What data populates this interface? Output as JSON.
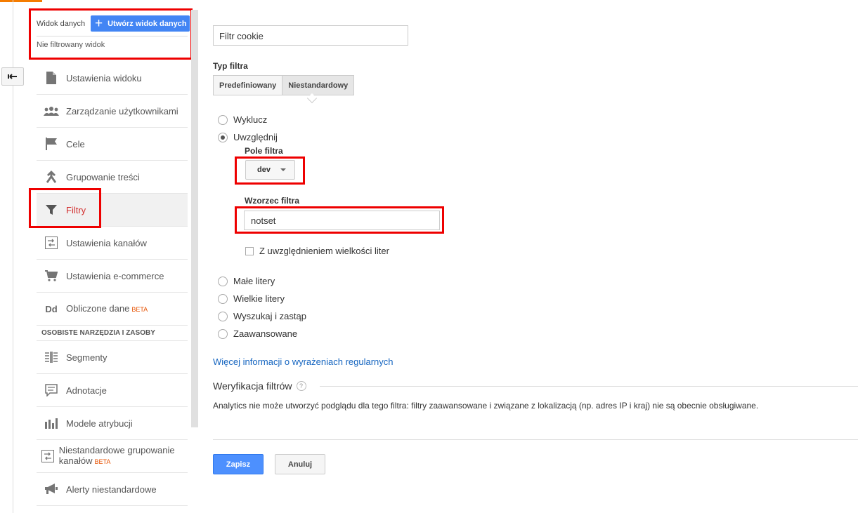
{
  "view": {
    "label": "Widok danych",
    "create_button": "Utwórz widok danych",
    "selected": "Nie filtrowany widok"
  },
  "sidebar": {
    "items": [
      {
        "label": "Ustawienia widoku",
        "icon": "document-icon"
      },
      {
        "label": "Zarządzanie użytkownikami",
        "icon": "users-icon"
      },
      {
        "label": "Cele",
        "icon": "flag-icon"
      },
      {
        "label": "Grupowanie treści",
        "icon": "merge-icon"
      },
      {
        "label": "Filtry",
        "icon": "filter-icon",
        "active": true
      },
      {
        "label": "Ustawienia kanałów",
        "icon": "channel-icon"
      },
      {
        "label": "Ustawienia e-commerce",
        "icon": "cart-icon"
      },
      {
        "label": "Obliczone dane",
        "beta": "BETA",
        "icon": "dd-icon"
      }
    ],
    "section_title": "OSOBISTE NARZĘDZIA I ZASOBY",
    "personal_items": [
      {
        "label": "Segmenty",
        "icon": "segments-icon"
      },
      {
        "label": "Adnotacje",
        "icon": "annotation-icon"
      },
      {
        "label": "Modele atrybucji",
        "icon": "bar-chart-icon"
      },
      {
        "label": "Niestandardowe grupowanie kanałów",
        "beta": "BETA",
        "icon": "channel-icon"
      },
      {
        "label": "Alerty niestandardowe",
        "icon": "megaphone-icon"
      }
    ],
    "dd_glyph": "Dd"
  },
  "form": {
    "filter_name": "Filtr cookie",
    "filter_type_label": "Typ filtra",
    "type_predefined": "Predefiniowany",
    "type_custom": "Niestandardowy",
    "option_exclude": "Wyklucz",
    "option_include": "Uwzględnij",
    "field_label": "Pole filtra",
    "field_value": "dev",
    "pattern_label": "Wzorzec filtra",
    "pattern_value": "notset",
    "case_sensitive": "Z uwzględnieniem wielkości liter",
    "option_lowercase": "Małe litery",
    "option_uppercase": "Wielkie litery",
    "option_search_replace": "Wyszukaj i zastąp",
    "option_advanced": "Zaawansowane",
    "regex_link": "Więcej informacji o wyrażeniach regularnych",
    "verification_title": "Weryfikacja filtrów",
    "help_glyph": "?",
    "verification_text": "Analytics nie może utworzyć podglądu dla tego filtra: filtry zaawansowane i związane z lokalizacją (np. adres IP i kraj) nie są obecnie obsługiwane.",
    "save": "Zapisz",
    "cancel": "Anuluj"
  },
  "colors": {
    "accent_blue": "#4285f4",
    "highlight_red": "#e00000",
    "active_red": "#d32f2f"
  }
}
